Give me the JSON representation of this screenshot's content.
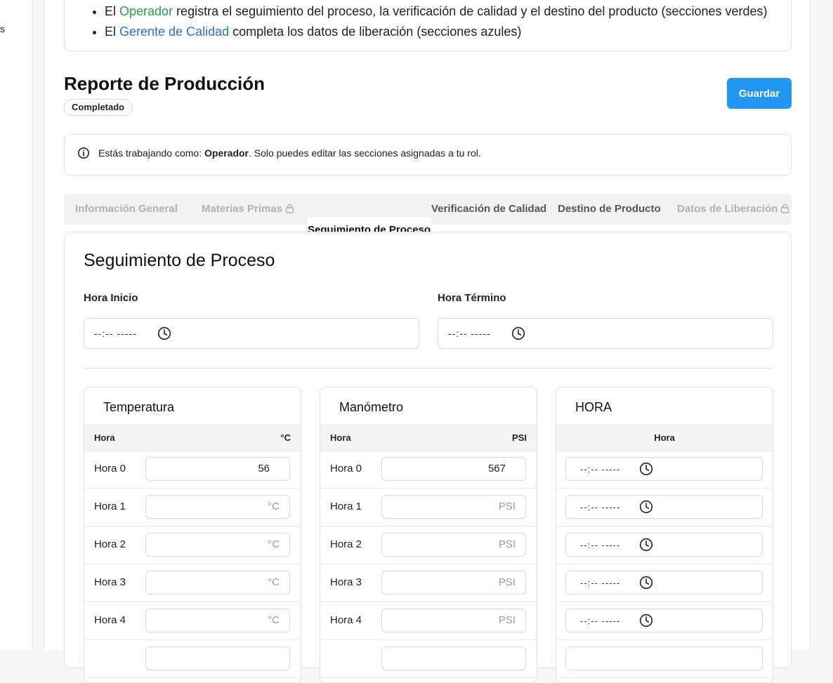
{
  "sidebar": {
    "fragment": "s"
  },
  "intro": {
    "item1": {
      "prefix": "El ",
      "role": "Operador",
      "text": " registra el seguimiento del proceso, la verificación de calidad y el destino del producto (secciones verdes)"
    },
    "item2": {
      "prefix": "El ",
      "role": "Gerente de Calidad",
      "text": " completa los datos de liberación (secciones azules)"
    }
  },
  "header": {
    "title": "Reporte de Producción",
    "status": "Completado",
    "save_label": "Guardar"
  },
  "notice": {
    "prefix": "Estás trabajando como: ",
    "role": "Operador",
    "suffix": ". Solo puedes editar las secciones asignadas a tu rol."
  },
  "tabs": [
    {
      "label": "Información General",
      "state": "disabled"
    },
    {
      "label": "Materias Primas",
      "state": "locked"
    },
    {
      "label": "Seguimiento de Proceso",
      "state": "active"
    },
    {
      "label": "Verificación de Calidad",
      "state": "enabled"
    },
    {
      "label": "Destino de Producto",
      "state": "enabled"
    },
    {
      "label": "Datos de Liberación",
      "state": "locked"
    }
  ],
  "section": {
    "title": "Seguimiento de Proceso",
    "start_label": "Hora Inicio",
    "end_label": "Hora Término",
    "time_placeholder": "--:-- -----"
  },
  "temperature": {
    "title": "Temperatura",
    "col_hour": "Hora",
    "col_unit": "°C",
    "rows": [
      {
        "label": "Hora 0",
        "value": "56",
        "placeholder": "°C"
      },
      {
        "label": "Hora 1",
        "value": "",
        "placeholder": "°C"
      },
      {
        "label": "Hora 2",
        "value": "",
        "placeholder": "°C"
      },
      {
        "label": "Hora 3",
        "value": "",
        "placeholder": "°C"
      },
      {
        "label": "Hora 4",
        "value": "",
        "placeholder": "°C"
      }
    ]
  },
  "pressure": {
    "title": "Manómetro",
    "col_hour": "Hora",
    "col_unit": "PSI",
    "rows": [
      {
        "label": "Hora 0",
        "value": "567",
        "placeholder": "PSI"
      },
      {
        "label": "Hora 1",
        "value": "",
        "placeholder": "PSI"
      },
      {
        "label": "Hora 2",
        "value": "",
        "placeholder": "PSI"
      },
      {
        "label": "Hora 3",
        "value": "",
        "placeholder": "PSI"
      },
      {
        "label": "Hora 4",
        "value": "",
        "placeholder": "PSI"
      }
    ]
  },
  "hours": {
    "title": "HORA",
    "col_hour": "Hora",
    "rows": [
      {
        "placeholder": "--:-- -----"
      },
      {
        "placeholder": "--:-- -----"
      },
      {
        "placeholder": "--:-- -----"
      },
      {
        "placeholder": "--:-- -----"
      },
      {
        "placeholder": "--:-- -----"
      }
    ]
  },
  "colors": {
    "accent": "#2196f3",
    "operator": "#22a14a",
    "manager": "#2f6fe0"
  }
}
